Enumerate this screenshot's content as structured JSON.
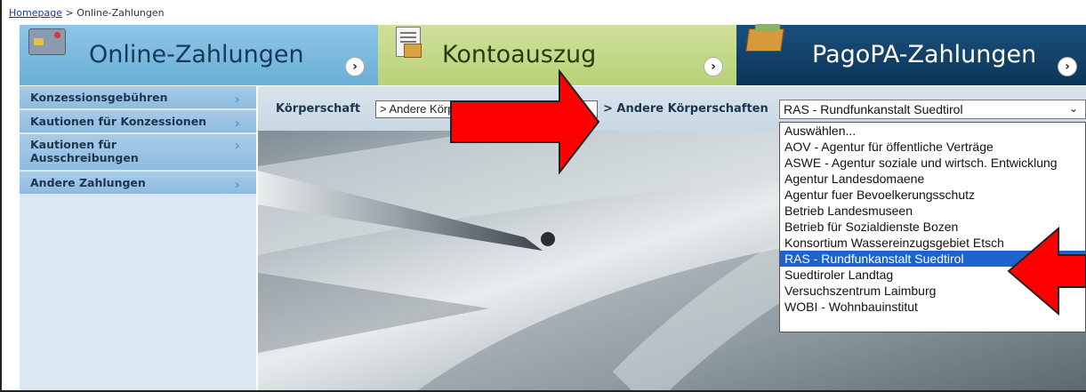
{
  "breadcrumb": {
    "home": "Homepage",
    "sep": " > ",
    "current": "Online-Zahlungen"
  },
  "tabs": [
    {
      "label": "Online-Zahlungen",
      "arrow": "›",
      "icon": "credit-card-icon"
    },
    {
      "label": "Kontoauszug",
      "arrow": "›",
      "icon": "document-icon"
    },
    {
      "label": "PagoPA-Zahlungen",
      "arrow": "›",
      "icon": "folder-icon"
    }
  ],
  "sidebar": {
    "items": [
      {
        "label": "Konzessionsgebühren",
        "chevron": "›"
      },
      {
        "label": "Kautionen für Konzessionen",
        "chevron": "›"
      },
      {
        "label": "Kautionen für Ausschreibungen",
        "chevron": "›"
      },
      {
        "label": "Andere Zahlungen",
        "chevron": "›"
      }
    ]
  },
  "filters": {
    "koerperschaft_label": "Körperschaft",
    "koerperschaft_value": "> Andere Körperschaften",
    "andere_label": "> Andere Körperschaften",
    "andere_value": "RAS - Rundfunkanstalt Suedtirol",
    "andere_chevron": "⌄"
  },
  "dropdown": {
    "selected_index": 8,
    "options": [
      "Auswählen...",
      "AOV - Agentur für öffentliche Verträge",
      "ASWE - Agentur soziale und wirtsch. Entwicklung",
      "Agentur Landesdomaene",
      "Agentur fuer Bevoelkerungsschutz",
      "Betrieb Landesmuseen",
      "Betrieb für Sozialdienste Bozen",
      "Konsortium Wassereinzugsgebiet Etsch",
      "RAS - Rundfunkanstalt Suedtirol",
      "Suedtiroler Landtag",
      "Versuchszentrum Laimburg",
      "WOBI - Wohnbauinstitut"
    ]
  },
  "colors": {
    "tab_online": "#7bb8de",
    "tab_konto": "#c4d985",
    "tab_pago": "#0f3f68",
    "sidebar_item": "#9cc3e3",
    "selection": "#1e62d0",
    "annotation_arrow": "#ff0000"
  }
}
